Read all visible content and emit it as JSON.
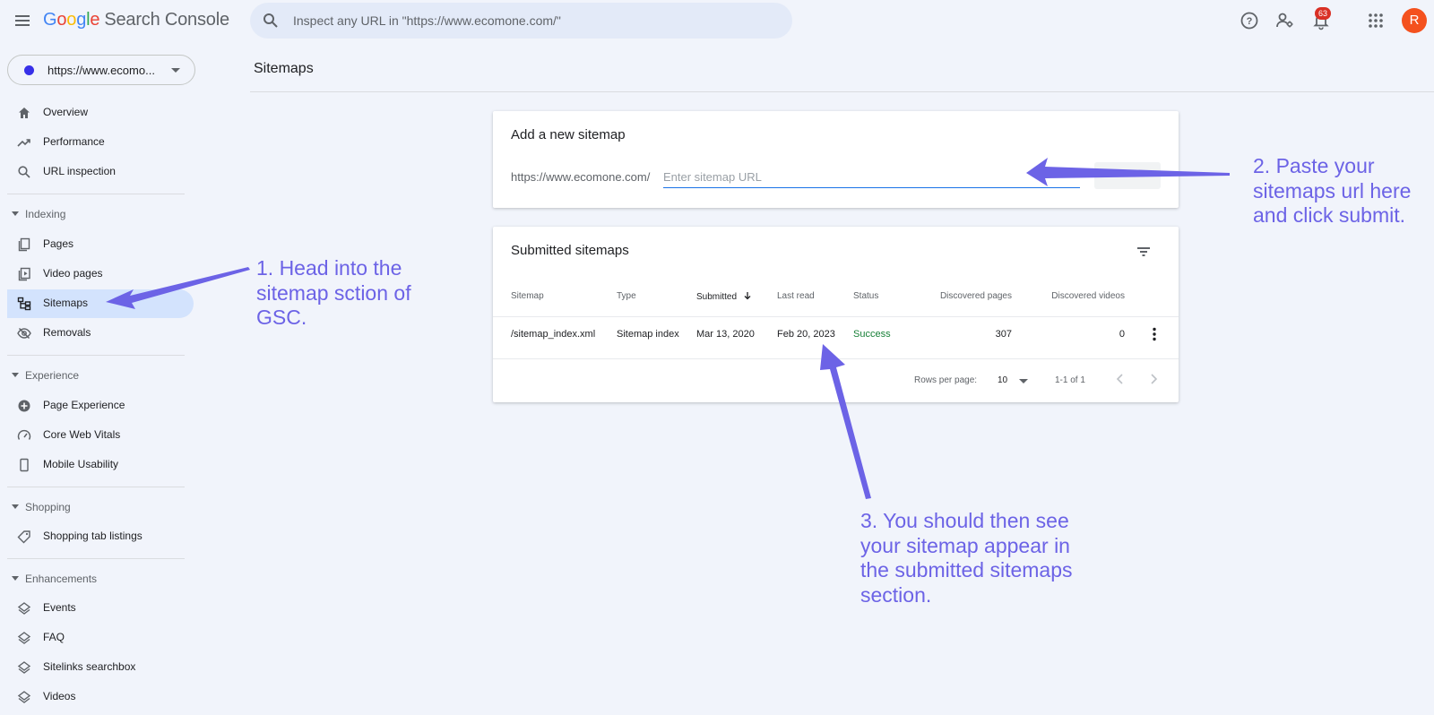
{
  "header": {
    "logo_google": [
      "G",
      "o",
      "o",
      "g",
      "l",
      "e"
    ],
    "logo_product": "Search Console",
    "search_placeholder": "Inspect any URL in \"https://www.ecomone.com/\"",
    "notification_count": "63",
    "avatar_letter": "R"
  },
  "sidebar": {
    "property": "https://www.ecomo...",
    "items_top": [
      {
        "label": "Overview",
        "icon": "home-icon"
      },
      {
        "label": "Performance",
        "icon": "trending-icon"
      },
      {
        "label": "URL inspection",
        "icon": "search-icon"
      }
    ],
    "sections": [
      {
        "label": "Indexing",
        "items": [
          {
            "label": "Pages",
            "icon": "pages-icon"
          },
          {
            "label": "Video pages",
            "icon": "video-icon"
          },
          {
            "label": "Sitemaps",
            "icon": "sitemap-icon",
            "active": true
          },
          {
            "label": "Removals",
            "icon": "eye-off-icon"
          }
        ]
      },
      {
        "label": "Experience",
        "items": [
          {
            "label": "Page Experience",
            "icon": "plus-circle-icon"
          },
          {
            "label": "Core Web Vitals",
            "icon": "gauge-icon"
          },
          {
            "label": "Mobile Usability",
            "icon": "phone-icon"
          }
        ]
      },
      {
        "label": "Shopping",
        "items": [
          {
            "label": "Shopping tab listings",
            "icon": "tag-icon"
          }
        ]
      },
      {
        "label": "Enhancements",
        "items": [
          {
            "label": "Events",
            "icon": "layers-icon"
          },
          {
            "label": "FAQ",
            "icon": "layers-icon"
          },
          {
            "label": "Sitelinks searchbox",
            "icon": "layers-icon"
          },
          {
            "label": "Videos",
            "icon": "layers-icon"
          }
        ]
      }
    ]
  },
  "page": {
    "title": "Sitemaps"
  },
  "add_sitemap": {
    "title": "Add a new sitemap",
    "prefix": "https://www.ecomone.com/",
    "placeholder": "Enter sitemap URL",
    "submit_label": ""
  },
  "submitted": {
    "title": "Submitted sitemaps",
    "columns": [
      "Sitemap",
      "Type",
      "Submitted",
      "Last read",
      "Status",
      "Discovered pages",
      "Discovered videos"
    ],
    "rows": [
      {
        "sitemap": "/sitemap_index.xml",
        "type": "Sitemap index",
        "submitted": "Mar 13, 2020",
        "last_read": "Feb 20, 2023",
        "status": "Success",
        "pages": "307",
        "videos": "0"
      }
    ],
    "rows_per_page_label": "Rows per page:",
    "rows_per_page": "10",
    "range": "1-1 of 1"
  },
  "annotations": {
    "step1": [
      "1. Head into the",
      "sitemap sction of",
      "GSC."
    ],
    "step2": [
      "2. Paste your",
      "sitemaps url here",
      "and click submit."
    ],
    "step3": [
      "3. You should then see",
      "your sitemap appear in",
      "the submitted sitemaps",
      "section."
    ]
  },
  "colors": {
    "accent": "#1a73e8",
    "annotation": "#6c63e6",
    "active_nav": "#d3e3fd",
    "success": "#188038"
  }
}
